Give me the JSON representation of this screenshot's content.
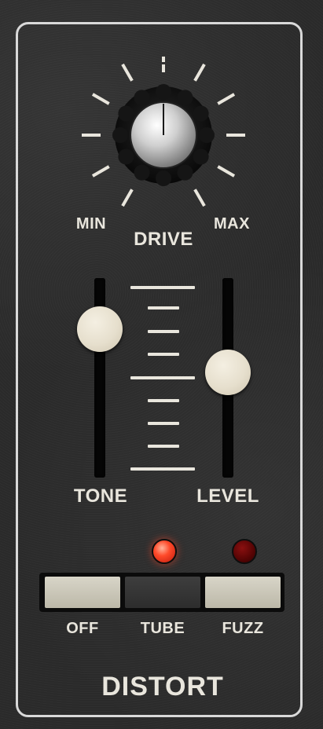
{
  "module": {
    "title": "DISTORT"
  },
  "drive_knob": {
    "label": "DRIVE",
    "min_label": "MIN",
    "max_label": "MAX",
    "value_fraction": 0.5,
    "icon": "rotary-knob-icon"
  },
  "tone_slider": {
    "label": "TONE",
    "value_fraction": 0.75
  },
  "level_slider": {
    "label": "LEVEL",
    "value_fraction": 0.55
  },
  "mode_switch": {
    "options": [
      {
        "label": "OFF",
        "has_led": false
      },
      {
        "label": "TUBE",
        "has_led": true,
        "led_on": true
      },
      {
        "label": "FUZZ",
        "has_led": true,
        "led_on": false
      }
    ],
    "selected": "TUBE"
  },
  "colors": {
    "panel": "#2c2c2c",
    "frame": "#d9d9d9",
    "label": "#e9e6dd",
    "led_on": "#ff4a2a",
    "led_off": "#5a0505",
    "thumb": "#e6dfcd"
  }
}
